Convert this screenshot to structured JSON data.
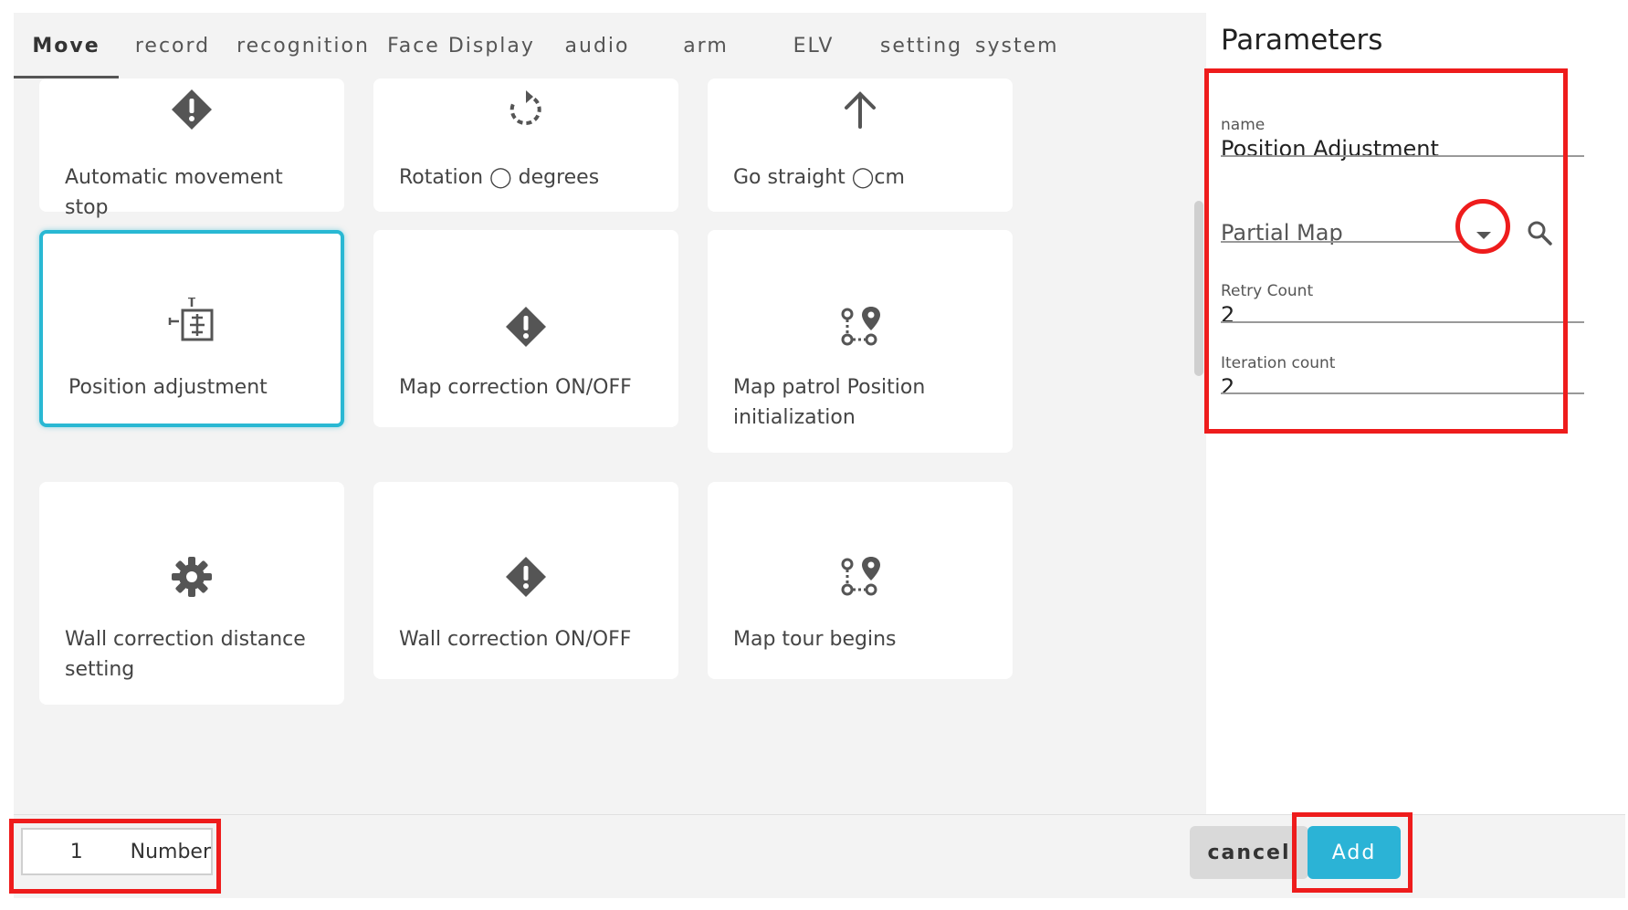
{
  "tabs": [
    "Move",
    "record",
    "recognition",
    "Face Display",
    "audio",
    "arm",
    "ELV",
    "setting",
    "system"
  ],
  "cards": [
    {
      "label": "Automatic movement stop",
      "icon": "warning-diamond-icon"
    },
    {
      "label": "Rotation ◯ degrees",
      "icon": "rotate-icon"
    },
    {
      "label": "Go straight ◯cm",
      "icon": "arrow-up-icon"
    },
    {
      "label": "Position adjustment",
      "icon": "position-adjust-icon"
    },
    {
      "label": "Map correction ON/OFF",
      "icon": "warning-diamond-icon"
    },
    {
      "label": "Map patrol Position initialization",
      "icon": "route-pin-icon"
    },
    {
      "label": "Wall correction distance setting",
      "icon": "gear-icon"
    },
    {
      "label": "Wall correction ON/OFF",
      "icon": "warning-diamond-icon"
    },
    {
      "label": "Map tour begins",
      "icon": "route-pin-icon"
    }
  ],
  "selected_card": "Position adjustment",
  "params": {
    "title": "Parameters",
    "name_label": "name",
    "name_value": "Position Adjustment",
    "map_placeholder": "Partial Map",
    "retry_label": "Retry Count",
    "retry_value": "2",
    "iteration_label": "Iteration count",
    "iteration_value": "2"
  },
  "bottom": {
    "number_value": "1",
    "number_unit": "Number",
    "cancel_label": "cancel",
    "add_label": "Add"
  },
  "colors": {
    "accent": "#2bb3d6",
    "selected_border": "#29b8d3",
    "highlight_red": "#ee1c1c",
    "icon_gray": "#555555"
  }
}
